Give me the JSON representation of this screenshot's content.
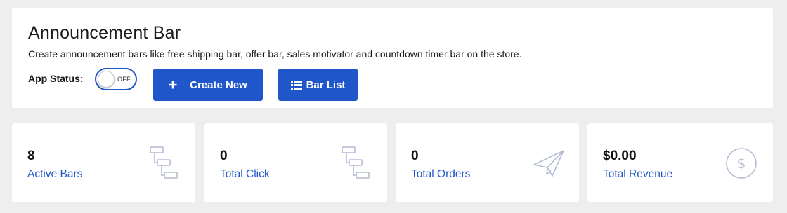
{
  "header": {
    "title": "Announcement Bar",
    "subtitle": "Create announcement bars like free shipping bar, offer bar, sales motivator and countdown timer bar on the store.",
    "app_status_label": "App Status:",
    "toggle_state": "OFF",
    "create_button_label": "Create New",
    "bar_list_button_label": "Bar List"
  },
  "stats": [
    {
      "value": "8",
      "label": "Active Bars",
      "icon": "hierarchy-icon"
    },
    {
      "value": "0",
      "label": "Total Click",
      "icon": "hierarchy-icon"
    },
    {
      "value": "0",
      "label": "Total Orders",
      "icon": "paper-plane-icon"
    },
    {
      "value": "$0.00",
      "label": "Total Revenue",
      "icon": "dollar-circle-icon"
    }
  ],
  "colors": {
    "accent": "#1f56c9",
    "icon_muted": "#b4bcd4",
    "background": "#eeeeee"
  }
}
